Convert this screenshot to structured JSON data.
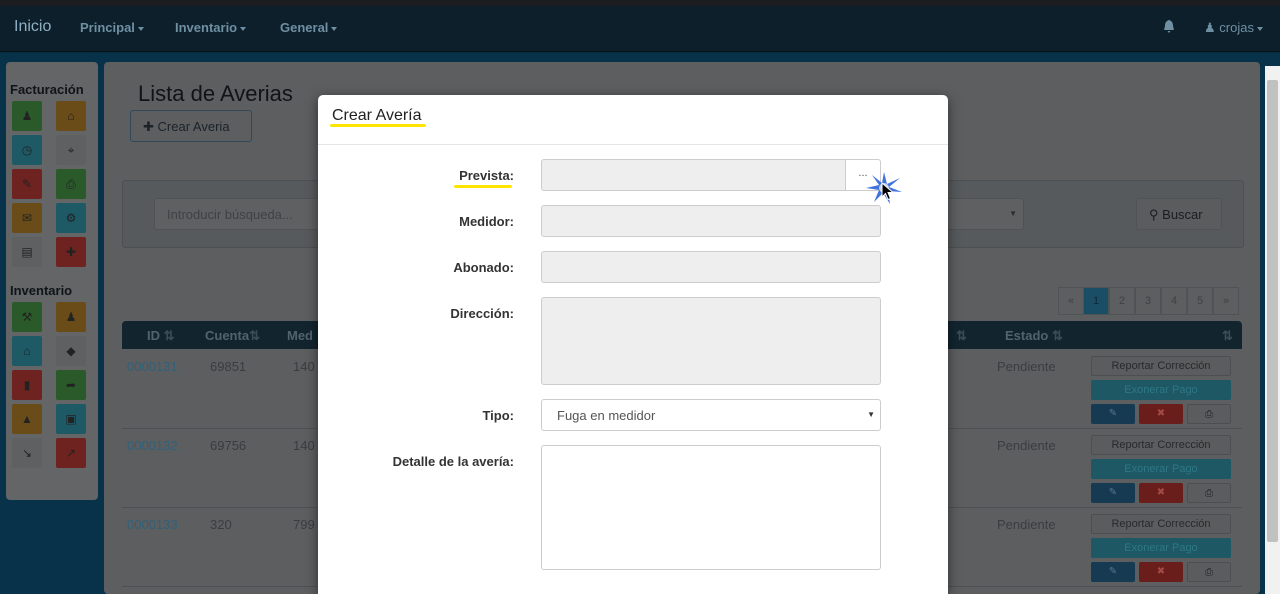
{
  "navbar": {
    "brand": "Inicio",
    "menus": [
      "Principal",
      "Inventario",
      "General"
    ],
    "user": "crojas"
  },
  "sidebar": {
    "section1_title": "Facturación",
    "section2_title": "Inventario",
    "section1_tiles": [
      {
        "icon": "user-icon",
        "glyph": "♟",
        "color": "#2a5a2a"
      },
      {
        "icon": "home-icon",
        "glyph": "⌂",
        "color": "#6a4c18"
      },
      {
        "icon": "clock-icon",
        "glyph": "◷",
        "color": "#1e5966"
      },
      {
        "icon": "map-marker-icon",
        "glyph": "⌖",
        "color": "#5e6062"
      },
      {
        "icon": "pencil-icon",
        "glyph": "✎",
        "color": "#6e2320"
      },
      {
        "icon": "print-icon",
        "glyph": "⎙",
        "color": "#2a5a2a"
      },
      {
        "icon": "envelope-icon",
        "glyph": "✉",
        "color": "#6a4c18"
      },
      {
        "icon": "gear-icon",
        "glyph": "⚙",
        "color": "#1e5966"
      },
      {
        "icon": "file-icon",
        "glyph": "▤",
        "color": "#5e6062"
      },
      {
        "icon": "plus-icon",
        "glyph": "✚",
        "color": "#6e2320"
      }
    ],
    "section2_tiles": [
      {
        "icon": "wrench-icon",
        "glyph": "⚒",
        "color": "#2a5a2a"
      },
      {
        "icon": "user-icon",
        "glyph": "♟",
        "color": "#6a4c18"
      },
      {
        "icon": "home-icon",
        "glyph": "⌂",
        "color": "#1e5966"
      },
      {
        "icon": "tag-icon",
        "glyph": "◆",
        "color": "#5e6062"
      },
      {
        "icon": "bookmark-icon",
        "glyph": "▮",
        "color": "#6e2320"
      },
      {
        "icon": "share-icon",
        "glyph": "➦",
        "color": "#2a5a2a"
      },
      {
        "icon": "road-icon",
        "glyph": "▲",
        "color": "#6a4c18"
      },
      {
        "icon": "cart-icon",
        "glyph": "▣",
        "color": "#1e5966"
      },
      {
        "icon": "compress-icon",
        "glyph": "↘",
        "color": "#5e6062"
      },
      {
        "icon": "expand-icon",
        "glyph": "↗",
        "color": "#6e2320"
      }
    ]
  },
  "page": {
    "title": "Lista de Averias",
    "create_button": "Crear Averia",
    "search_placeholder": "Introducir búsqueda...",
    "search_button": "Buscar",
    "pagination": [
      "«",
      "1",
      "2",
      "3",
      "4",
      "5",
      "»"
    ],
    "active_page": "1"
  },
  "table": {
    "headers": {
      "id": "ID",
      "cuenta": "Cuenta",
      "medidor": "Med",
      "estado": "Estado"
    },
    "rows": [
      {
        "id": "0000131",
        "cuenta": "69851",
        "medidor": "140",
        "estado": "Pendiente"
      },
      {
        "id": "0000132",
        "cuenta": "69756",
        "medidor": "140",
        "estado": "Pendiente"
      },
      {
        "id": "0000133",
        "cuenta": "320",
        "medidor": "799",
        "estado": "Pendiente"
      }
    ],
    "action_report": "Reportar Corrección",
    "action_exonerate": "Exonerar Pago"
  },
  "modal": {
    "title": "Crear Avería",
    "fields": {
      "prevista": "Prevista:",
      "medidor": "Medidor:",
      "abonado": "Abonado:",
      "direccion": "Dirección:",
      "tipo": "Tipo:",
      "detalle": "Detalle de la avería:"
    },
    "browse_button": "...",
    "tipo_selected": "Fuga en medidor"
  }
}
